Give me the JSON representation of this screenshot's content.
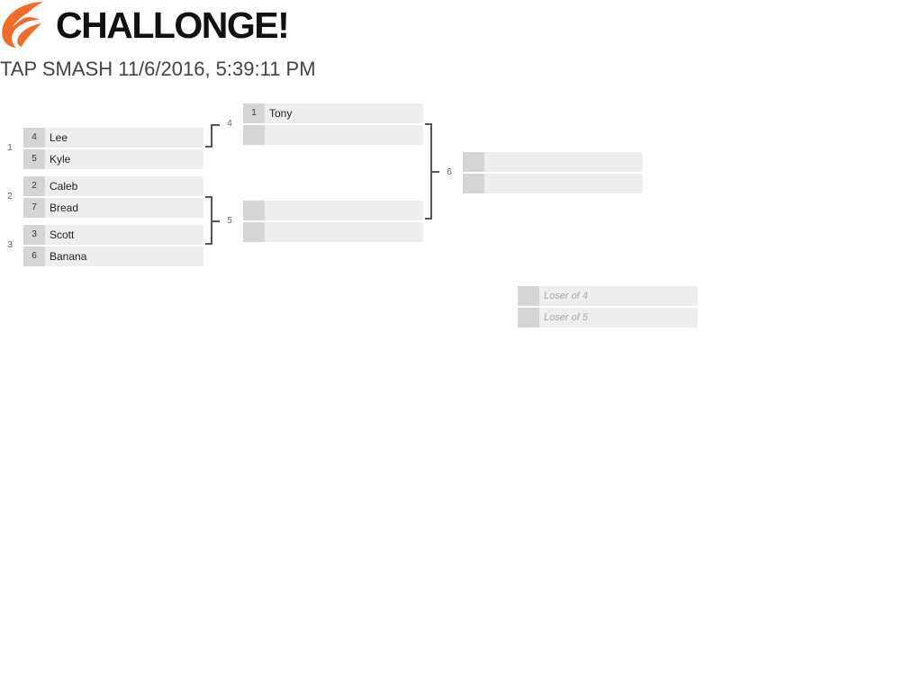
{
  "brand": {
    "name": "CHALLONGE!",
    "accent": "#ef6c2a"
  },
  "tournament": {
    "title": "TAP SMASH 11/6/2016, 5:39:11 PM"
  },
  "matches": {
    "m1": {
      "number": "1",
      "p1": {
        "seed": "4",
        "name": "Lee"
      },
      "p2": {
        "seed": "5",
        "name": "Kyle"
      }
    },
    "m2": {
      "number": "2",
      "p1": {
        "seed": "2",
        "name": "Caleb"
      },
      "p2": {
        "seed": "7",
        "name": "Bread"
      }
    },
    "m3": {
      "number": "3",
      "p1": {
        "seed": "3",
        "name": "Scott"
      },
      "p2": {
        "seed": "6",
        "name": "Banana"
      }
    },
    "m4": {
      "number": "4",
      "p1": {
        "seed": "1",
        "name": "Tony"
      },
      "p2": {
        "seed": "",
        "name": ""
      }
    },
    "m5": {
      "number": "5",
      "p1": {
        "seed": "",
        "name": ""
      },
      "p2": {
        "seed": "",
        "name": ""
      }
    },
    "m6": {
      "number": "6",
      "p1": {
        "seed": "",
        "name": ""
      },
      "p2": {
        "seed": "",
        "name": ""
      }
    },
    "third": {
      "p1": {
        "seed": "",
        "name": "Loser of 4"
      },
      "p2": {
        "seed": "",
        "name": "Loser of 5"
      }
    }
  }
}
